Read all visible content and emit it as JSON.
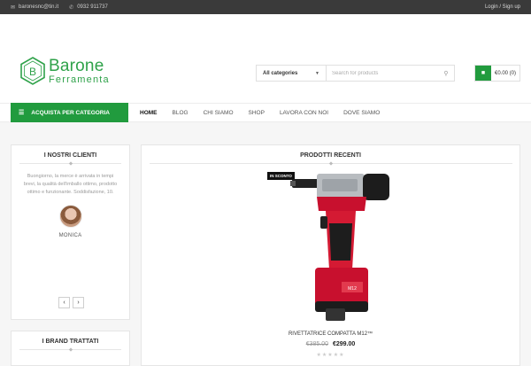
{
  "topbar": {
    "email": "baronesnc@tin.it",
    "phone": "0932 911737",
    "login": "Login / Sign up",
    "email_icon": "envelope-icon",
    "phone_icon": "phone-icon"
  },
  "logo": {
    "title": "Barone",
    "subtitle": "Ferramenta"
  },
  "search": {
    "category": "All categories",
    "placeholder": "Search for products"
  },
  "cart": {
    "summary": "€0.00 (0)"
  },
  "nav": {
    "category_button": "ACQUISTA PER CATEGORIA",
    "items": [
      "HOME",
      "BLOG",
      "CHI SIAMO",
      "SHOP",
      "LAVORA CON NOI",
      "DOVE SIAMO"
    ]
  },
  "clients": {
    "title": "I NOSTRI CLIENTI",
    "testimonial": "Buongiorno, la merce è arrivata in tempi brevi, la qualità dell'imballo ottimo, prodotto ottimo e funzionante. Soddisfazione, 10.",
    "name": "MONICA"
  },
  "brands": {
    "title": "I BRAND TRATTATI"
  },
  "recent": {
    "title": "PRODOTTI RECENTI",
    "badge": "IN SCONTO",
    "product_name": "RIVETTATRICE COMPATTA M12™",
    "old_price": "€385.00",
    "new_price": "€299.00",
    "rating": 0
  },
  "colors": {
    "accent": "#219b3e",
    "topbar": "#3a3a3a"
  }
}
